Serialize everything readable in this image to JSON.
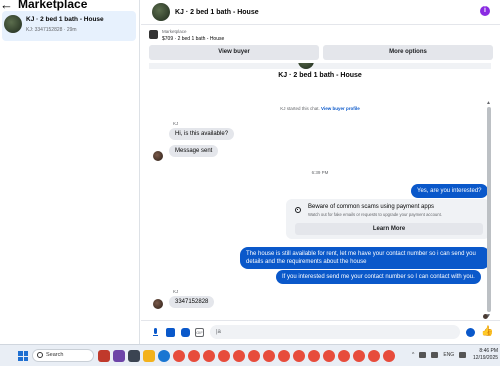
{
  "sidebar": {
    "title": "Marketplace",
    "back_glyph": "←",
    "conversation": {
      "name": "KJ · 2 bed 1 bath - House",
      "sub": "KJ: 3347152828 · 29m"
    }
  },
  "chat": {
    "header": {
      "title": "KJ · 2 bed 1 bath - House",
      "info_glyph": "i"
    },
    "listing": {
      "label": "Marketplace",
      "value": "$709 · 2 bed 1 bath - House"
    },
    "buttons": {
      "view_buyer": "View buyer",
      "more_options": "More options"
    },
    "thread": {
      "title": "KJ · 2 bed 1 bath - House",
      "started_text": "KJ started this chat.",
      "view_profile": "View buyer profile",
      "sender_1": "KJ",
      "msg_1": "Hi, is this available?",
      "msg_2": "Message sent",
      "time": "6:39 PM",
      "out_1": "Yes, are you interested?",
      "warning": {
        "title": "Beware of common scams using payment apps",
        "sub": "Watch out for fake emails or requests to upgrade your payment account.",
        "button": "Learn More"
      },
      "out_2": "The house is still available for rent, let me have your contact number so i can send you details and the requirements about the house",
      "out_3": "If you interested send me your contact number so I can contact with you.",
      "sender_2": "KJ",
      "msg_3": "3347152828"
    },
    "composer": {
      "input_value": "|a",
      "gif_label": "GIF",
      "like_glyph": "👍"
    }
  },
  "taskbar": {
    "search_placeholder": "Search",
    "tray": {
      "lang": "ENG",
      "up_glyph": "^"
    },
    "clock": {
      "time": "8:46 PM",
      "date": "12/19/2025"
    }
  },
  "colors": {
    "accent": "#0a58ca",
    "bubble_in": "#e4e6eb",
    "selected_item": "#e7f1fd",
    "info_icon": "#8a2be2"
  }
}
